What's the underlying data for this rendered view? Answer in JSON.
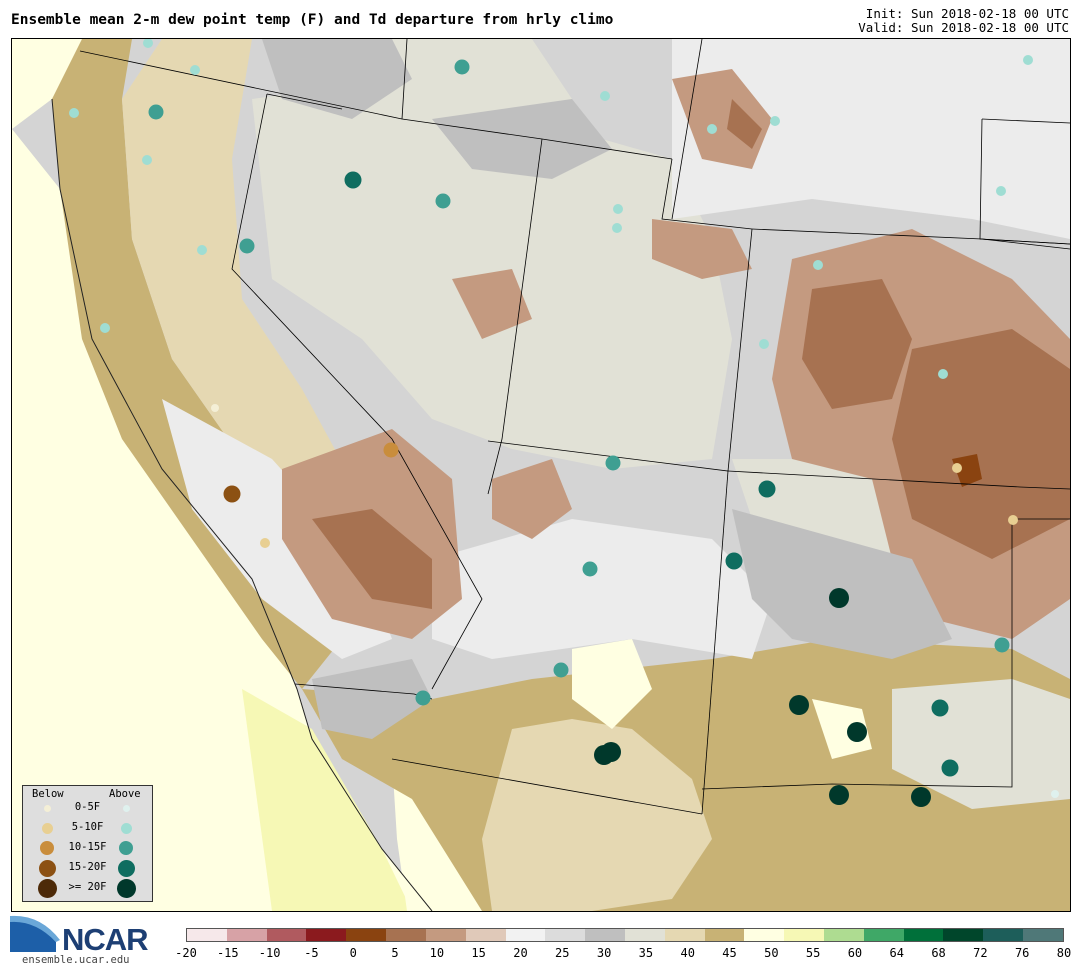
{
  "header": {
    "title": "Ensemble mean 2-m dew point temp (F) and Td departure from hrly climo",
    "init": "Init: Sun 2018-02-18 00 UTC",
    "valid": "Valid: Sun 2018-02-18 00 UTC"
  },
  "legend": {
    "below_header": "Below",
    "above_header": "Above",
    "rows": [
      {
        "label": "0-5F",
        "below_color": "#f4efd6",
        "above_color": "#dff1ee"
      },
      {
        "label": "5-10F",
        "below_color": "#e8cf92",
        "above_color": "#9fddd3"
      },
      {
        "label": "10-15F",
        "below_color": "#c98d3c",
        "above_color": "#3f9f92"
      },
      {
        "label": "15-20F",
        "below_color": "#8c5113",
        "above_color": "#0f6d60"
      },
      {
        "label": ">= 20F",
        "below_color": "#4d2a08",
        "above_color": "#00382b"
      }
    ]
  },
  "colorbar": {
    "tick_labels": [
      "-20",
      "-15",
      "-10",
      "-5",
      "0",
      "5",
      "10",
      "15",
      "20",
      "25",
      "30",
      "35",
      "40",
      "45",
      "50",
      "55",
      "60",
      "64",
      "68",
      "72",
      "76",
      "80"
    ],
    "colors": [
      "#f6e8ea",
      "#d7a2a6",
      "#b05a5f",
      "#8b1a1e",
      "#8a4310",
      "#a77251",
      "#c49a80",
      "#e0c9b9",
      "#f2f2f2",
      "#dcdcdc",
      "#bfbfbf",
      "#e1e1d6",
      "#e5d8b2",
      "#c8b275",
      "#ffffe2",
      "#f6f8b5",
      "#aedc91",
      "#3fa867",
      "#00703a",
      "#00462b",
      "#1d5e5a",
      "#4f7878"
    ]
  },
  "logo": {
    "wordmark": "NCAR",
    "site": "ensemble.ucar.edu"
  },
  "stations": [
    {
      "kind": "above",
      "level": 3,
      "color": "#3f9f92"
    },
    {
      "kind": "below",
      "level": 4,
      "color": "#8c5113"
    },
    {
      "kind": "above",
      "level": 5,
      "color": "#00382b"
    }
  ]
}
